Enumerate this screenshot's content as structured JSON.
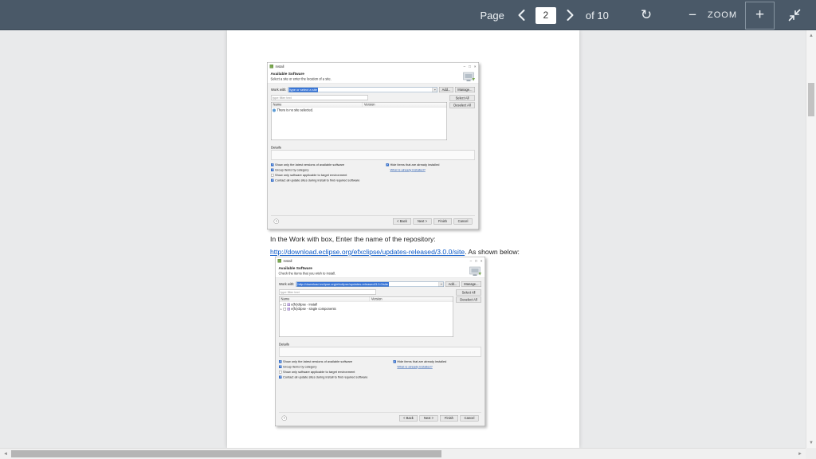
{
  "toolbar": {
    "page_label": "Page",
    "page_value": "2",
    "of_label": "of 10",
    "zoom_label": "ZOOM"
  },
  "icons": {
    "refresh": "↻",
    "zoom_out": "−",
    "zoom_in": "+",
    "combo_arrow": "▾",
    "tree_twisty": "▸",
    "scroll_up": "▲",
    "scroll_down": "▼",
    "scroll_left": "◄",
    "scroll_right": "►"
  },
  "window_controls": {
    "minimize": "–",
    "maximize": "□",
    "close": "×"
  },
  "document": {
    "paragraph": "In the Work with box, Enter the name of the repository:",
    "link_text": "http://download.eclipse.org/efxclipse/updates-released/3.0.0/site",
    "link_suffix": ". As shown below:"
  },
  "dialog1": {
    "window_title": "Install",
    "heading": "Available Software",
    "subheading": "Select a site or enter the location of a site.",
    "work_with_label": "Work with:",
    "work_with_value": "type or select a site",
    "add_button": "Add...",
    "manage_button": "Manage...",
    "filter_placeholder": "type filter text",
    "select_all_button": "Select All",
    "deselect_all_button": "Deselect All",
    "col_name": "Name",
    "col_version": "Version",
    "empty_row": "There is no site selected.",
    "details_label": "Details",
    "options_left": [
      {
        "label": "Show only the latest versions of available software",
        "checked": true
      },
      {
        "label": "Group items by category",
        "checked": true
      },
      {
        "label": "Show only software applicable to target environment",
        "checked": false
      },
      {
        "label": "Contact all update sites during install to find required software",
        "checked": true
      }
    ],
    "options_right": [
      {
        "label": "Hide items that are already installed",
        "checked": true
      }
    ],
    "installed_link": "What is already installed?",
    "help_label": "?",
    "back_button": "< Back",
    "next_button": "Next >",
    "finish_button": "Finish",
    "cancel_button": "Cancel"
  },
  "dialog2": {
    "window_title": "Install",
    "heading": "Available Software",
    "subheading": "Check the items that you wish to install.",
    "work_with_label": "Work with:",
    "work_with_value": "http://download.eclipse.org/efxclipse/updates-released/3.0.0/site",
    "add_button": "Add...",
    "manage_button": "Manage...",
    "filter_placeholder": "type filter text",
    "select_all_button": "Select All",
    "deselect_all_button": "Deselect All",
    "col_name": "Name",
    "col_version": "Version",
    "rows": [
      {
        "label": "e(fx)clipse - install"
      },
      {
        "label": "e(fx)clipse - single components"
      }
    ],
    "details_label": "Details",
    "options_left": [
      {
        "label": "Show only the latest versions of available software",
        "checked": true
      },
      {
        "label": "Group items by category",
        "checked": true
      },
      {
        "label": "Show only software applicable to target environment",
        "checked": false
      },
      {
        "label": "Contact all update sites during install to find required software",
        "checked": true
      }
    ],
    "options_right": [
      {
        "label": "Hide items that are already installed",
        "checked": true
      }
    ],
    "installed_link": "What is already installed?",
    "help_label": "?",
    "back_button": "< Back",
    "next_button": "Next >",
    "finish_button": "Finish",
    "cancel_button": "Cancel"
  }
}
